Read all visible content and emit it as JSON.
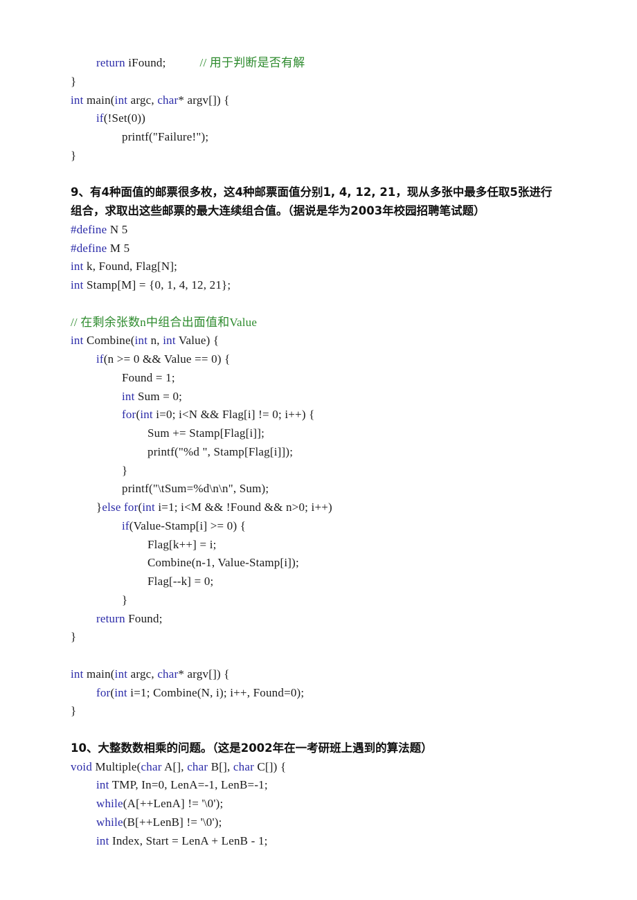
{
  "document": {
    "lines": [
      {
        "type": "code",
        "indent": 1,
        "tokens": [
          [
            "kw",
            "return"
          ],
          [
            "tx",
            " iFound;"
          ],
          [
            "tx",
            "           "
          ],
          [
            "cm",
            "// 用于判断是否有解"
          ]
        ]
      },
      {
        "type": "code",
        "indent": 0,
        "tokens": [
          [
            "tx",
            "}"
          ]
        ]
      },
      {
        "type": "code",
        "indent": 0,
        "tokens": [
          [
            "kw",
            "int"
          ],
          [
            "tx",
            " main("
          ],
          [
            "kw",
            "int"
          ],
          [
            "tx",
            " argc, "
          ],
          [
            "kw",
            "char"
          ],
          [
            "tx",
            "* argv[]) {"
          ]
        ]
      },
      {
        "type": "code",
        "indent": 1,
        "tokens": [
          [
            "kw",
            "if"
          ],
          [
            "tx",
            "(!Set(0))"
          ]
        ]
      },
      {
        "type": "code",
        "indent": 2,
        "tokens": [
          [
            "tx",
            "printf(\"Failure!\");"
          ]
        ]
      },
      {
        "type": "code",
        "indent": 0,
        "tokens": [
          [
            "tx",
            "}"
          ]
        ]
      },
      {
        "type": "blank"
      },
      {
        "type": "heading",
        "text": "9、有4种面值的邮票很多枚，这4种邮票面值分别1, 4, 12, 21，现从多张中最多任取5张进行"
      },
      {
        "type": "heading",
        "text": "组合，求取出这些邮票的最大连续组合值。（据说是华为2003年校园招聘笔试题）"
      },
      {
        "type": "code",
        "indent": 0,
        "tokens": [
          [
            "pp",
            "#define"
          ],
          [
            "tx",
            " N 5"
          ]
        ]
      },
      {
        "type": "code",
        "indent": 0,
        "tokens": [
          [
            "pp",
            "#define"
          ],
          [
            "tx",
            " M 5"
          ]
        ]
      },
      {
        "type": "code",
        "indent": 0,
        "tokens": [
          [
            "kw",
            "int"
          ],
          [
            "tx",
            " k, Found, Flag[N];"
          ]
        ]
      },
      {
        "type": "code",
        "indent": 0,
        "tokens": [
          [
            "kw",
            "int"
          ],
          [
            "tx",
            " Stamp[M] = {0, 1, 4, 12, 21};"
          ]
        ]
      },
      {
        "type": "blank"
      },
      {
        "type": "code",
        "indent": 0,
        "tokens": [
          [
            "cm",
            "// 在剩余张数n中组合出面值和Value"
          ]
        ]
      },
      {
        "type": "code",
        "indent": 0,
        "tokens": [
          [
            "kw",
            "int"
          ],
          [
            "tx",
            " Combine("
          ],
          [
            "kw",
            "int"
          ],
          [
            "tx",
            " n, "
          ],
          [
            "kw",
            "int"
          ],
          [
            "tx",
            " Value) {"
          ]
        ]
      },
      {
        "type": "code",
        "indent": 1,
        "tokens": [
          [
            "kw",
            "if"
          ],
          [
            "tx",
            "(n >= 0 && Value == 0) {"
          ]
        ]
      },
      {
        "type": "code",
        "indent": 2,
        "tokens": [
          [
            "tx",
            "Found = 1;"
          ]
        ]
      },
      {
        "type": "code",
        "indent": 2,
        "tokens": [
          [
            "kw",
            "int"
          ],
          [
            "tx",
            " Sum = 0;"
          ]
        ]
      },
      {
        "type": "code",
        "indent": 2,
        "tokens": [
          [
            "kw",
            "for"
          ],
          [
            "tx",
            "("
          ],
          [
            "kw",
            "int"
          ],
          [
            "tx",
            " i=0; i<N && Flag[i] != 0; i++) {"
          ]
        ]
      },
      {
        "type": "code",
        "indent": 3,
        "tokens": [
          [
            "tx",
            "Sum += Stamp[Flag[i]];"
          ]
        ]
      },
      {
        "type": "code",
        "indent": 3,
        "tokens": [
          [
            "tx",
            "printf(\"%d \", Stamp[Flag[i]]);"
          ]
        ]
      },
      {
        "type": "code",
        "indent": 2,
        "tokens": [
          [
            "tx",
            "}"
          ]
        ]
      },
      {
        "type": "code",
        "indent": 2,
        "tokens": [
          [
            "tx",
            "printf(\"\\tSum=%d\\n\\n\", Sum);"
          ]
        ]
      },
      {
        "type": "code",
        "indent": 1,
        "tokens": [
          [
            "tx",
            "}"
          ],
          [
            "kw",
            "else for"
          ],
          [
            "tx",
            "("
          ],
          [
            "kw",
            "int"
          ],
          [
            "tx",
            " i=1; i<M && !Found && n>0; i++)"
          ]
        ]
      },
      {
        "type": "code",
        "indent": 2,
        "tokens": [
          [
            "kw",
            "if"
          ],
          [
            "tx",
            "(Value-Stamp[i] >= 0) {"
          ]
        ]
      },
      {
        "type": "code",
        "indent": 3,
        "tokens": [
          [
            "tx",
            "Flag[k++] = i;"
          ]
        ]
      },
      {
        "type": "code",
        "indent": 3,
        "tokens": [
          [
            "tx",
            "Combine(n-1, Value-Stamp[i]);"
          ]
        ]
      },
      {
        "type": "code",
        "indent": 3,
        "tokens": [
          [
            "tx",
            "Flag[--k] = 0;"
          ]
        ]
      },
      {
        "type": "code",
        "indent": 2,
        "tokens": [
          [
            "tx",
            "}"
          ]
        ]
      },
      {
        "type": "code",
        "indent": 1,
        "tokens": [
          [
            "kw",
            "return"
          ],
          [
            "tx",
            " Found;"
          ]
        ]
      },
      {
        "type": "code",
        "indent": 0,
        "tokens": [
          [
            "tx",
            "}"
          ]
        ]
      },
      {
        "type": "blank"
      },
      {
        "type": "code",
        "indent": 0,
        "tokens": [
          [
            "kw",
            "int"
          ],
          [
            "tx",
            " main("
          ],
          [
            "kw",
            "int"
          ],
          [
            "tx",
            " argc, "
          ],
          [
            "kw",
            "char"
          ],
          [
            "tx",
            "* argv[]) {"
          ]
        ]
      },
      {
        "type": "code",
        "indent": 1,
        "tokens": [
          [
            "kw",
            "for"
          ],
          [
            "tx",
            "("
          ],
          [
            "kw",
            "int"
          ],
          [
            "tx",
            " i=1; Combine(N, i); i++, Found=0);"
          ]
        ]
      },
      {
        "type": "code",
        "indent": 0,
        "tokens": [
          [
            "tx",
            "}"
          ]
        ]
      },
      {
        "type": "blank"
      },
      {
        "type": "heading",
        "text": "10、大整数数相乘的问题。（这是2002年在一考研班上遇到的算法题）"
      },
      {
        "type": "code",
        "indent": 0,
        "tokens": [
          [
            "kw",
            "void"
          ],
          [
            "tx",
            " Multiple("
          ],
          [
            "kw",
            "char"
          ],
          [
            "tx",
            " A[], "
          ],
          [
            "kw",
            "char"
          ],
          [
            "tx",
            " B[], "
          ],
          [
            "kw",
            "char"
          ],
          [
            "tx",
            " C[]) {"
          ]
        ]
      },
      {
        "type": "code",
        "indent": 1,
        "tokens": [
          [
            "kw",
            "int"
          ],
          [
            "tx",
            " TMP, In=0, LenA=-1, LenB=-1;"
          ]
        ]
      },
      {
        "type": "code",
        "indent": 1,
        "tokens": [
          [
            "kw",
            "while"
          ],
          [
            "tx",
            "(A[++LenA] != '\\0');"
          ]
        ]
      },
      {
        "type": "code",
        "indent": 1,
        "tokens": [
          [
            "kw",
            "while"
          ],
          [
            "tx",
            "(B[++LenB] != '\\0');"
          ]
        ]
      },
      {
        "type": "code",
        "indent": 1,
        "tokens": [
          [
            "kw",
            "int"
          ],
          [
            "tx",
            " Index, Start = LenA + LenB - 1;"
          ]
        ]
      }
    ]
  },
  "colors": {
    "keyword": "#2b2ba8",
    "comment": "#2e8b2e",
    "text": "#1a1a1a",
    "background": "#ffffff"
  }
}
